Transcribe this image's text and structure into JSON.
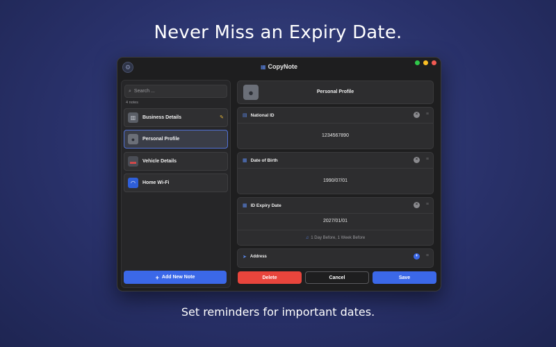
{
  "promo": {
    "headline": "Never Miss an Expiry Date.",
    "subline": "Set reminders for important dates."
  },
  "window": {
    "title": "CopyNote",
    "settings_icon": "gear-icon"
  },
  "sidebar": {
    "search_placeholder": "Search ...",
    "note_count": "4 notes",
    "items": [
      {
        "label": "Business Details",
        "icon": "building-icon",
        "pinned": true
      },
      {
        "label": "Personal Profile",
        "icon": "person-icon",
        "selected": true
      },
      {
        "label": "Vehicle Details",
        "icon": "car-icon"
      },
      {
        "label": "Home Wi-Fi",
        "icon": "wifi-icon"
      }
    ],
    "add_button": "Add New Note"
  },
  "detail": {
    "profile_title": "Personal Profile",
    "fields": [
      {
        "label": "National ID",
        "value": "1234567890"
      },
      {
        "label": "Date of Birth",
        "value": "1990/07/01"
      },
      {
        "label": "ID Expiry Date",
        "value": "2027/01/01",
        "reminder": "1 Day Before, 1 Week Before"
      },
      {
        "label": "Address",
        "value": ""
      }
    ]
  },
  "actions": {
    "delete": "Delete",
    "cancel": "Cancel",
    "save": "Save"
  },
  "colors": {
    "accent": "#3b68e8",
    "danger": "#e8453c",
    "pin": "#e8b73a",
    "background": "#29316a"
  }
}
